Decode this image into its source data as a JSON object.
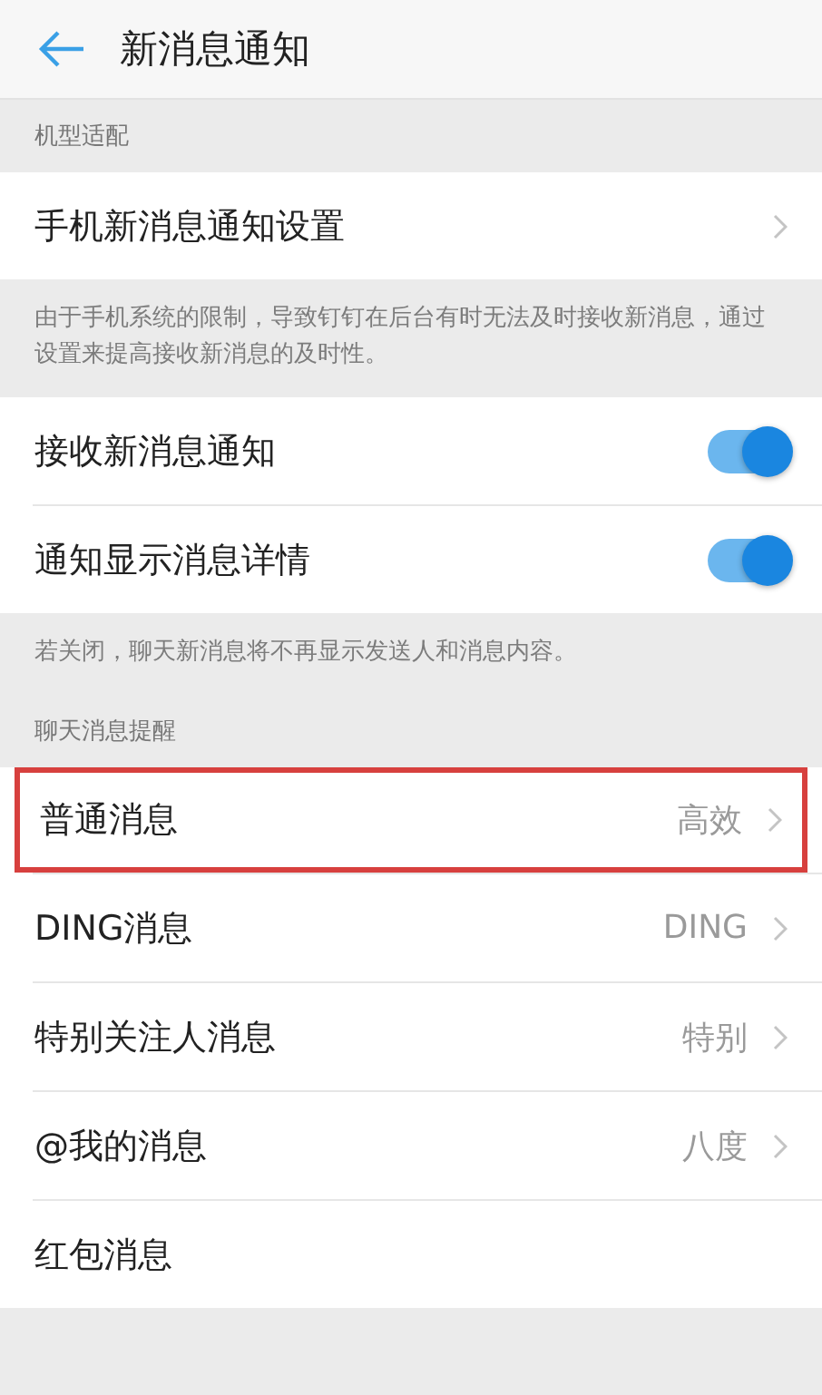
{
  "header": {
    "title": "新消息通知"
  },
  "sections": [
    {
      "kind": "label",
      "text": "机型适配"
    },
    {
      "kind": "group",
      "rows": [
        {
          "kind": "link",
          "label": "手机新消息通知设置",
          "chevron": true,
          "highlighted": false
        }
      ]
    },
    {
      "kind": "note",
      "text": "由于手机系统的限制，导致钉钉在后台有时无法及时接收新消息，通过设置来提高接收新消息的及时性。"
    },
    {
      "kind": "group",
      "rows": [
        {
          "kind": "toggle",
          "label": "接收新消息通知",
          "on": true
        },
        {
          "kind": "toggle",
          "label": "通知显示消息详情",
          "on": true
        }
      ]
    },
    {
      "kind": "note",
      "text": "若关闭，聊天新消息将不再显示发送人和消息内容。"
    },
    {
      "kind": "label",
      "text": "聊天消息提醒"
    },
    {
      "kind": "group",
      "rows": [
        {
          "kind": "link",
          "label": "普通消息",
          "value": "高效",
          "chevron": true,
          "highlighted": true
        },
        {
          "kind": "link",
          "label": "DING消息",
          "value": "DING",
          "chevron": true,
          "highlighted": false
        },
        {
          "kind": "link",
          "label": "特别关注人消息",
          "value": "特别",
          "chevron": true,
          "highlighted": false
        },
        {
          "kind": "link",
          "label": "@我的消息",
          "value": "八度",
          "chevron": true,
          "highlighted": false
        },
        {
          "kind": "link",
          "label": "红包消息",
          "chevron": false,
          "highlighted": false
        }
      ]
    }
  ]
}
